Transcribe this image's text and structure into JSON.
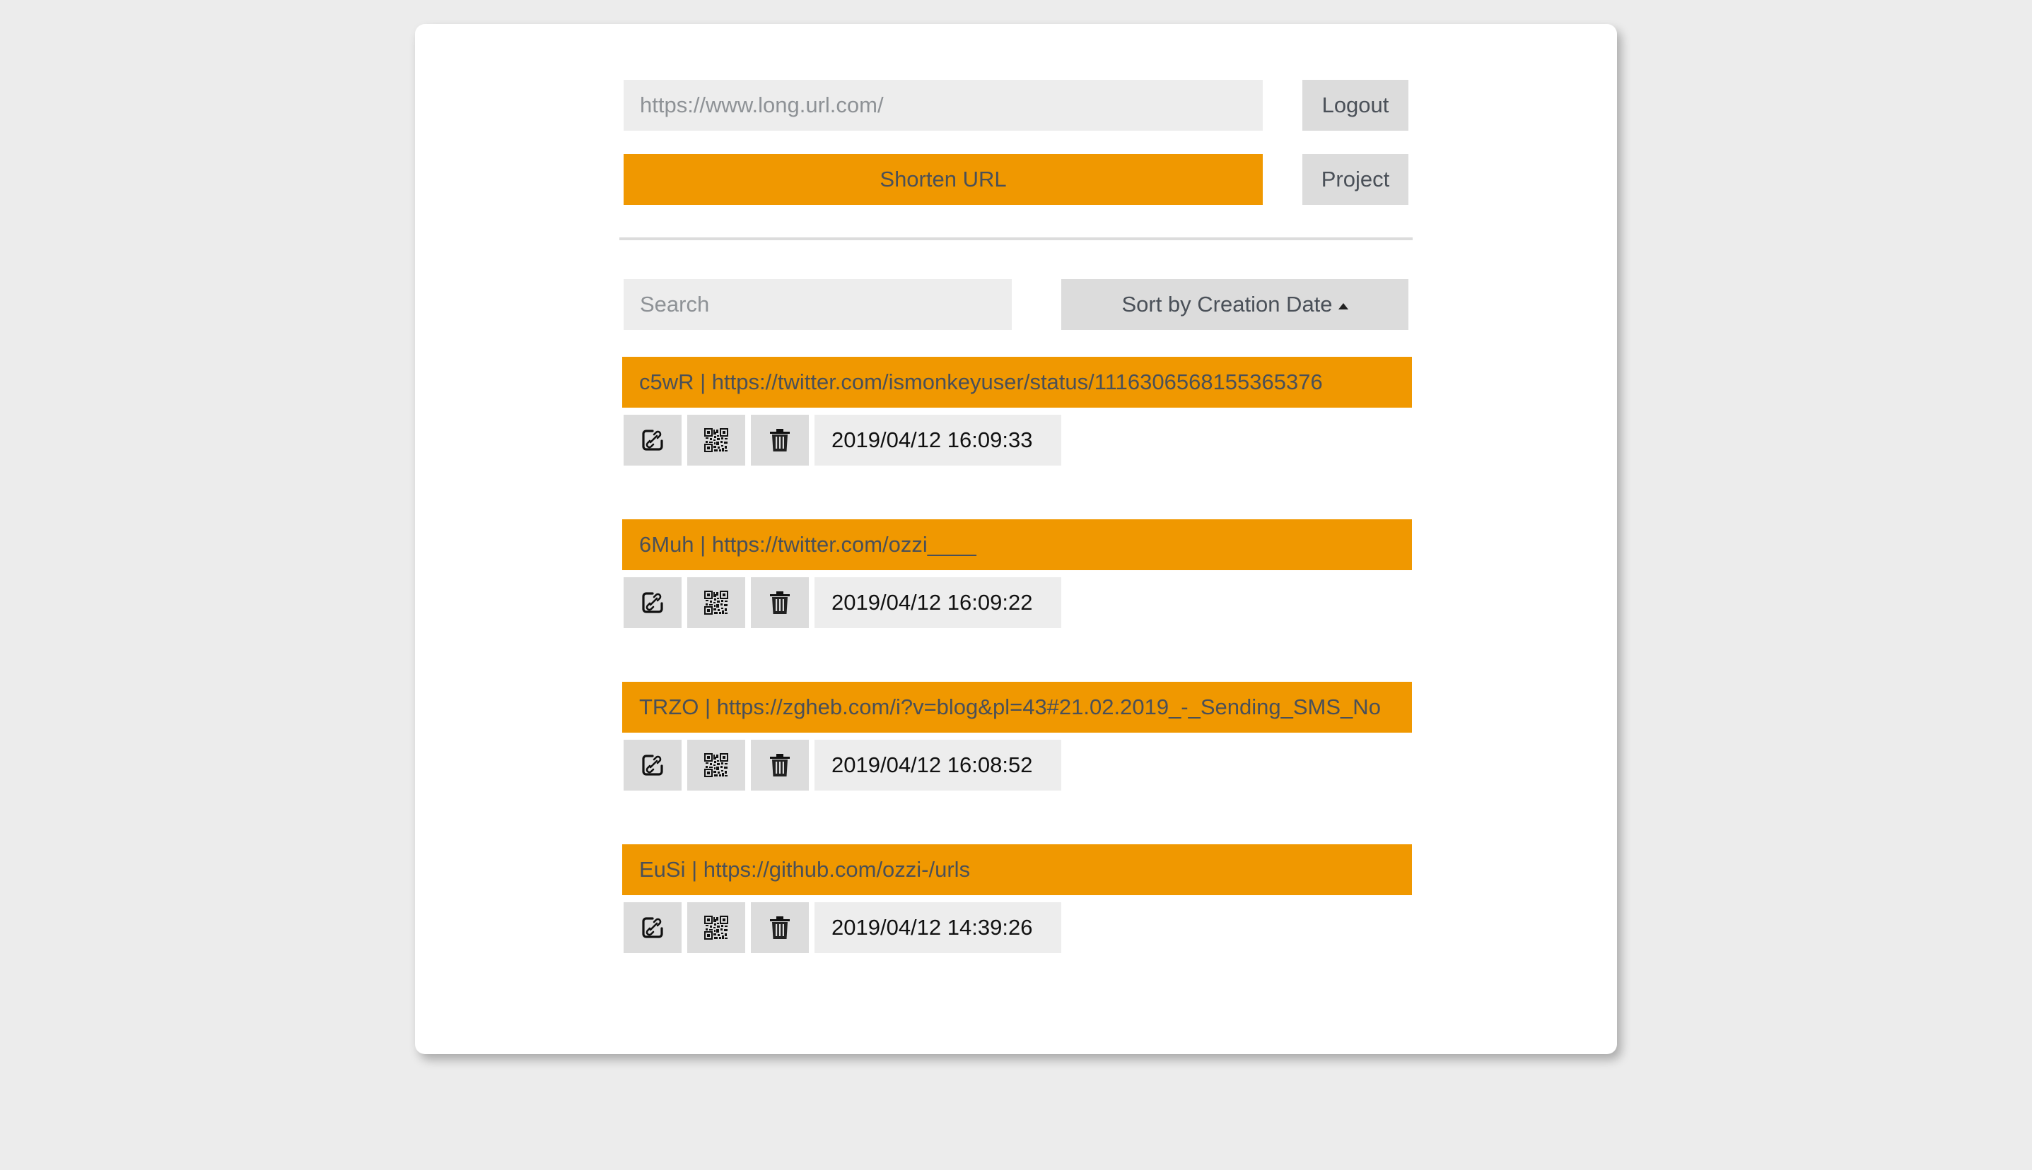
{
  "header": {
    "url_input": {
      "value": "",
      "placeholder": "https://www.long.url.com/"
    },
    "logout_label": "Logout",
    "shorten_label": "Shorten URL",
    "project_label": "Project"
  },
  "controls": {
    "search": {
      "value": "",
      "placeholder": "Search"
    },
    "sort_label": "Sort by Creation Date",
    "sort_direction": "ascending",
    "sort_icon": "caret-up-icon"
  },
  "colors": {
    "accent": "#f09800",
    "background": "#ececec",
    "button": "#dcdcdc",
    "input": "#ededed",
    "text": "#4a5058"
  },
  "icons": {
    "edit": "edit-link-icon",
    "qr": "qr-code-icon",
    "delete": "trash-icon"
  },
  "entries": [
    {
      "code": "c5wR",
      "url": "https://twitter.com/ismonkeyuser/status/1116306568155365376",
      "label": "c5wR | https://twitter.com/ismonkeyuser/status/1116306568155365376",
      "created": "2019/04/12 16:09:33"
    },
    {
      "code": "6Muh",
      "url": "https://twitter.com/ozzi____",
      "label": "6Muh | https://twitter.com/ozzi____",
      "created": "2019/04/12 16:09:22"
    },
    {
      "code": "TRZO",
      "url": "https://zgheb.com/i?v=blog&pl=43#21.02.2019_-_Sending_SMS_No",
      "label": "TRZO | https://zgheb.com/i?v=blog&pl=43#21.02.2019_-_Sending_SMS_No",
      "created": "2019/04/12 16:08:52"
    },
    {
      "code": "EuSi",
      "url": "https://github.com/ozzi-/urls",
      "label": "EuSi | https://github.com/ozzi-/urls",
      "created": "2019/04/12 14:39:26"
    }
  ]
}
